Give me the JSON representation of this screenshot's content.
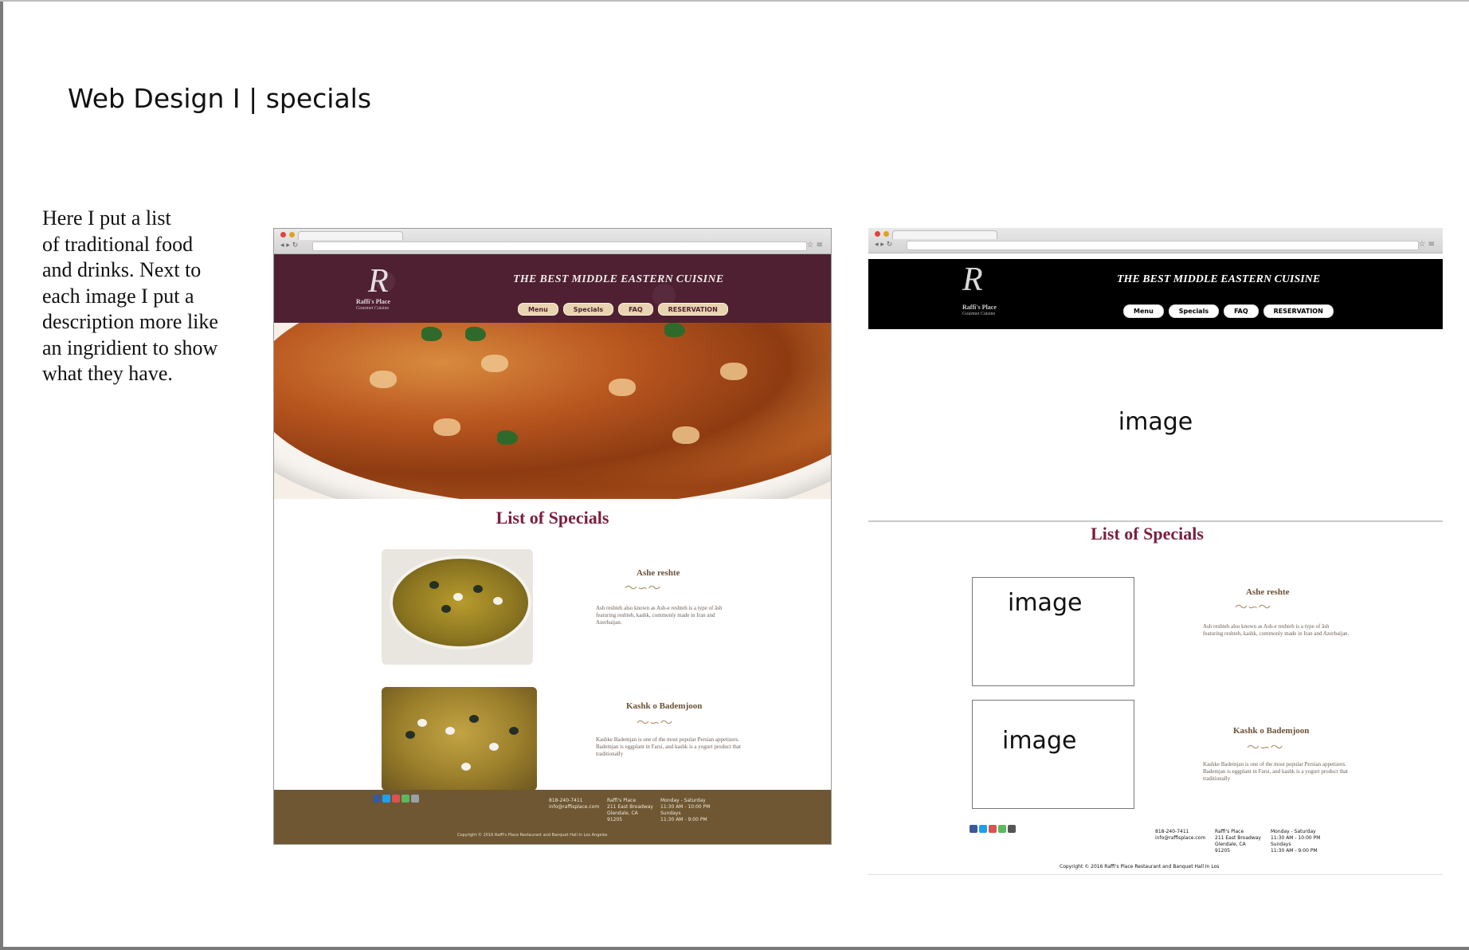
{
  "slide": {
    "title": "Web Design I | specials",
    "note": "Here I put a list\nof traditional food\nand drinks. Next to\neach image I put a\ndescription more like\nan ingridient to show\nwhat they have."
  },
  "site": {
    "logo_letter": "R",
    "logo_name": "Raffi's Place",
    "logo_sub": "Gourmet Cuisine",
    "tagline": "THE BEST MIDDLE EASTERN CUISINE",
    "nav": [
      "Menu",
      "Specials",
      "FAQ",
      "RESERVATION"
    ],
    "specials_title": "List of Specials",
    "dishes": [
      {
        "name": "Ashe reshte",
        "desc": "Ash reshteh also known as Ash-e reshteh is a type of āsh featuring reshteh, kashk, commonly made in Iran and Azerbaijan."
      },
      {
        "name": "Kashk o Bademjoon",
        "desc": "Kashke Bademjan is one of the most popular Persian appetizers. Bademjan is eggplant in Farsi, and kashk is a yogurt product that traditionally"
      }
    ],
    "footer": {
      "phone_email": "818-240-7411\ninfo@raffisplace.com",
      "address": "Raffi's Place\n211 East Broadway\nGlendale, CA\n91205",
      "hours": "Monday - Saturday\n11:30 AM - 10:00 PM\nSundays\n11:30 AM - 9:00 PM",
      "copyright": "Copyright © 2016 Raffi's Place Restaurant and Banquet Hall In Los Angeles",
      "copyright_short": "Copyright © 2016 Raffi's Place Restaurant and Banquet Hall In Los"
    }
  },
  "wireframe": {
    "placeholder": "image"
  }
}
